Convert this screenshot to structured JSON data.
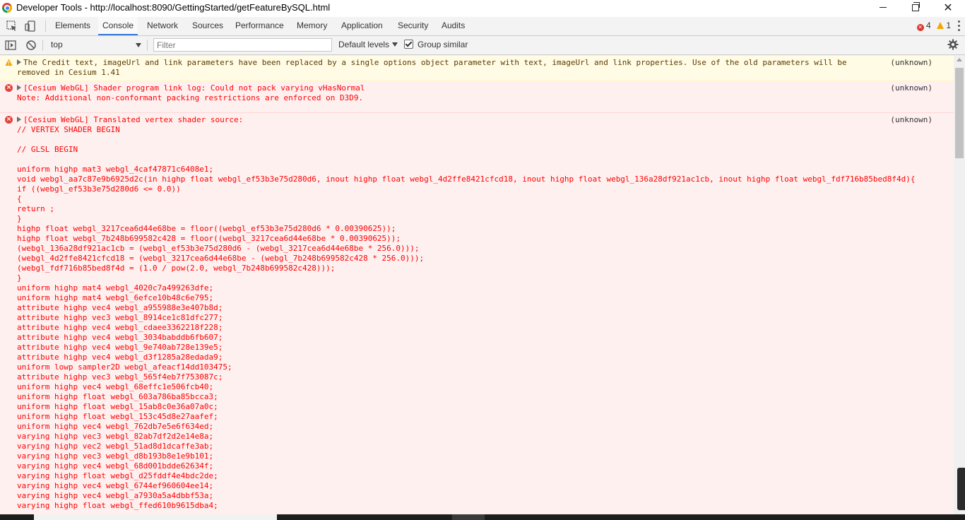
{
  "window": {
    "title": "Developer Tools - http://localhost:8090/GettingStarted/getFeatureBySQL.html",
    "minimize_label": "minimize",
    "restore_label": "restore",
    "close_glyph": "✕"
  },
  "tabs": [
    {
      "label": "Elements"
    },
    {
      "label": "Console",
      "active": true
    },
    {
      "label": "Network"
    },
    {
      "label": "Sources"
    },
    {
      "label": "Performance"
    },
    {
      "label": "Memory"
    },
    {
      "label": "Application"
    },
    {
      "label": "Security"
    },
    {
      "label": "Audits"
    }
  ],
  "counts": {
    "errors": "4",
    "warnings": "1"
  },
  "toolbar": {
    "context": "top",
    "filter_placeholder": "Filter",
    "levels_label": "Default levels",
    "group_similar_label": "Group similar",
    "group_similar_checked": true
  },
  "messages": [
    {
      "level": "warning",
      "text": "The Credit text, imageUrl and link parameters have been replaced by a single options object parameter with text, imageUrl and link properties. Use of the old parameters will be removed in Cesium 1.41",
      "source": "(unknown)"
    },
    {
      "level": "error",
      "text": "[Cesium WebGL] Shader program link log: Could not pack varying vHasNormal\nNote: Additional non-conformant packing restrictions are enforced on D3D9.",
      "source": "(unknown)"
    },
    {
      "level": "error",
      "text": "[Cesium WebGL] Translated vertex shader source:",
      "source": "(unknown)",
      "code": "// VERTEX SHADER BEGIN\n\n// GLSL BEGIN\n\nuniform highp mat3 webgl_4caf47871c6408e1;\nvoid webgl_aa7c87e9b6925d2c(in highp float webgl_ef53b3e75d280d6, inout highp float webgl_4d2ffe8421cfcd18, inout highp float webgl_136a28df921ac1cb, inout highp float webgl_fdf716b85bed8f4d){\nif ((webgl_ef53b3e75d280d6 <= 0.0))\n{\nreturn ;\n}\nhighp float webgl_3217cea6d44e68be = floor((webgl_ef53b3e75d280d6 * 0.00390625));\nhighp float webgl_7b248b699582c428 = floor((webgl_3217cea6d44e68be * 0.00390625));\n(webgl_136a28df921ac1cb = (webgl_ef53b3e75d280d6 - (webgl_3217cea6d44e68be * 256.0)));\n(webgl_4d2ffe8421cfcd18 = (webgl_3217cea6d44e68be - (webgl_7b248b699582c428 * 256.0)));\n(webgl_fdf716b85bed8f4d = (1.0 / pow(2.0, webgl_7b248b699582c428)));\n}\nuniform highp mat4 webgl_4020c7a499263dfe;\nuniform highp mat4 webgl_6efce10b48c6e795;\nattribute highp vec4 webgl_a955988e3e407b8d;\nattribute highp vec3 webgl_8914ce1c81dfc277;\nattribute highp vec4 webgl_cdaee3362218f228;\nattribute highp vec4 webgl_3034babddb6fb607;\nattribute highp vec4 webgl_9e740ab728e139e5;\nattribute highp vec4 webgl_d3f1285a28edada9;\nuniform lowp sampler2D webgl_afeacf14dd103475;\nattribute highp vec3 webgl_565f4eb7f753087c;\nuniform highp vec4 webgl_68effc1e506fcb40;\nuniform highp float webgl_603a786ba85bcca3;\nuniform highp float webgl_15ab8c0e36a07a0c;\nuniform highp float webgl_153c45d8e27aafef;\nuniform highp vec4 webgl_762db7e5e6f634ed;\nvarying highp vec3 webgl_82ab7df2d2e14e8a;\nvarying highp vec2 webgl_51ad8d1dcaffe3ab;\nvarying highp vec3 webgl_d8b193b8e1e9b101;\nvarying highp vec4 webgl_68d001bdde62634f;\nvarying highp float webgl_d25fddf4e4bdc2de;\nvarying highp vec4 webgl_6744ef960604ee14;\nvarying highp vec4 webgl_a7930a5a4dbbf53a;\nvarying highp float webgl_ffed610b9615dba4;"
    }
  ],
  "colors": {
    "error_text": "#ff0000",
    "error_bg": "#fff0f0",
    "warning_bg": "#fffbe5",
    "active_tab_underline": "#3879d9"
  },
  "icons": [
    "chrome-logo-icon",
    "inspect-element-icon",
    "device-toolbar-icon",
    "sidebar-toggle-icon",
    "clear-console-icon",
    "settings-gear-icon",
    "error-icon",
    "warning-icon",
    "expand-triangle-icon",
    "more-options-icon"
  ]
}
